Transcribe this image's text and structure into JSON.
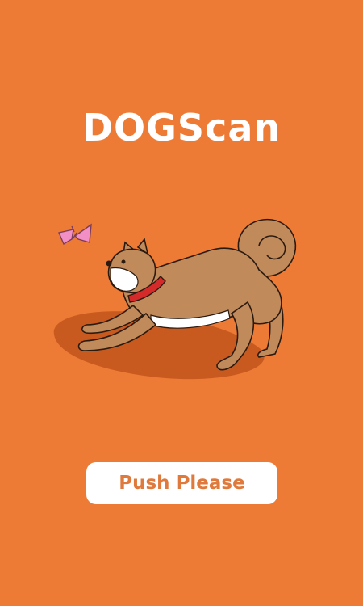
{
  "app": {
    "title": "DOGScan"
  },
  "illustration": {
    "subject": "shiba-inu-dog-play-bow-with-butterfly"
  },
  "actions": {
    "push_label": "Push Please"
  },
  "colors": {
    "background": "#ED7B35",
    "title_text": "#FFFFFF",
    "button_bg": "#FFFFFF",
    "button_text": "#E07A3C",
    "dog_fur": "#C08A5B",
    "dog_belly": "#FFFFFF",
    "collar": "#D42A2A",
    "shadow": "#C95A1F",
    "butterfly": "#F28FC4"
  }
}
